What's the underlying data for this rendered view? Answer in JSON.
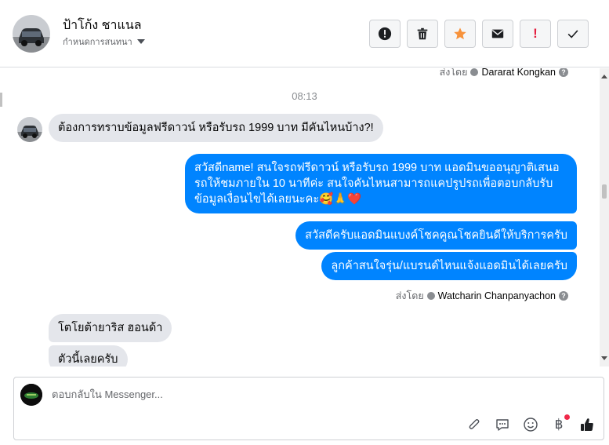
{
  "header": {
    "contact_name": "ป้าโก้ง ชาแนล",
    "assign_label": "กำหนดการสนทนา",
    "actions": [
      {
        "name": "report-spam-button",
        "icon": "alert-circle-icon"
      },
      {
        "name": "delete-button",
        "icon": "trash-icon"
      },
      {
        "name": "star-button",
        "icon": "star-icon"
      },
      {
        "name": "mark-unread-button",
        "icon": "envelope-icon"
      },
      {
        "name": "follow-up-button",
        "icon": "exclamation-icon"
      },
      {
        "name": "mark-done-button",
        "icon": "checkmark-icon"
      }
    ]
  },
  "thread": {
    "top_sent_by_prefix": "ส่งโดย",
    "top_sent_by_name": "Dararat Kongkan",
    "timestamp": "08:13",
    "messages": {
      "m1": "ต้องการทราบข้อมูลฟรีดาวน์ หรือรับรถ 1999 บาท มีคันไหนบ้าง?!",
      "m2": "สวัสดีname! สนใจรถฟรีดาวน์ หรือรับรถ 1999 บาท แอดมินขออนุญาติเสนอรถให้ชมภายใน 10 นาทีค่ะ สนใจคันไหนสามารถแคปรูปรถเพื่อตอบกลับรับข้อมูลเงื่อนไขได้เลยนะคะ🥰🙏❤️",
      "m3": "สวัสดีครับแอดมินแบงค์โชคคูณโชคยินดีให้บริการครับ",
      "m4": "ลูกค้าสนใจรุ่น/แบรนด์ไหนแจ้งแอดมินได้เลยครับ",
      "m5": "โตโยต้ายาริส ฮอนด้า",
      "m6": "ตัวนี้เลยครับ"
    },
    "sent_by_prefix": "ส่งโดย",
    "sent_by_name": "Watcharin Chanpanyachon"
  },
  "composer": {
    "placeholder": "ตอบกลับใน Messenger...",
    "tools": [
      "paperclip-icon",
      "saved-reply-icon",
      "emoji-icon",
      "baht-icon",
      "thumbs-up-icon"
    ]
  },
  "colors": {
    "outgoing_bubble": "#0084ff",
    "incoming_bubble": "#e4e6eb",
    "star_accent": "#f7923b",
    "alert_red": "#e41e3f"
  }
}
